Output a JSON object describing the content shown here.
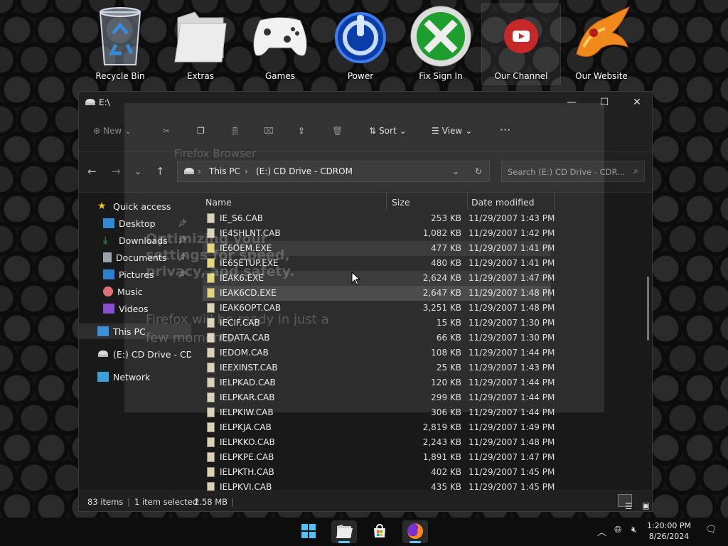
{
  "desktop": {
    "icons": [
      {
        "label": "Recycle Bin"
      },
      {
        "label": "Extras"
      },
      {
        "label": "Games"
      },
      {
        "label": "Power"
      },
      {
        "label": "Fix Sign In"
      },
      {
        "label": "Our Channel"
      },
      {
        "label": "Our Website"
      }
    ]
  },
  "window": {
    "title": "E:\\",
    "controls": {
      "minimize": "—",
      "maximize": "☐",
      "close": "✕"
    }
  },
  "toolbar": {
    "new_label": "New",
    "sort_label": "Sort",
    "view_label": "View",
    "more_label": "···"
  },
  "address": {
    "crumbs": [
      "This PC",
      "(E:) CD Drive - CDROM"
    ],
    "search_placeholder": "Search (E:) CD Drive - CDR..."
  },
  "sidebar": {
    "items": [
      {
        "label": "Quick access"
      },
      {
        "label": "Desktop"
      },
      {
        "label": "Downloads"
      },
      {
        "label": "Documents"
      },
      {
        "label": "Pictures"
      },
      {
        "label": "Music"
      },
      {
        "label": "Videos"
      },
      {
        "label": "This PC"
      },
      {
        "label": "(E:) CD Drive - CDR"
      },
      {
        "label": "Network"
      }
    ]
  },
  "columns": {
    "name": "Name",
    "size": "Size",
    "date": "Date modified"
  },
  "files": [
    {
      "name": "IE_S6.CAB",
      "size": "253 KB",
      "date": "11/29/2007 1:43 PM"
    },
    {
      "name": "IE4SHLNT.CAB",
      "size": "1,082 KB",
      "date": "11/29/2007 1:42 PM"
    },
    {
      "name": "IE6OEM.EXE",
      "size": "477 KB",
      "date": "11/29/2007 1:41 PM"
    },
    {
      "name": "IE6SETUP.EXE",
      "size": "480 KB",
      "date": "11/29/2007 1:41 PM"
    },
    {
      "name": "IEAK6.EXE",
      "size": "2,624 KB",
      "date": "11/29/2007 1:47 PM"
    },
    {
      "name": "IEAK6CD.EXE",
      "size": "2,647 KB",
      "date": "11/29/2007 1:48 PM"
    },
    {
      "name": "IEAK6OPT.CAB",
      "size": "3,251 KB",
      "date": "11/29/2007 1:48 PM"
    },
    {
      "name": "IECIF.CAB",
      "size": "15 KB",
      "date": "11/29/2007 1:30 PM"
    },
    {
      "name": "IEDATA.CAB",
      "size": "66 KB",
      "date": "11/29/2007 1:30 PM"
    },
    {
      "name": "IEDOM.CAB",
      "size": "108 KB",
      "date": "11/29/2007 1:44 PM"
    },
    {
      "name": "IEEXINST.CAB",
      "size": "25 KB",
      "date": "11/29/2007 1:43 PM"
    },
    {
      "name": "IELPKAD.CAB",
      "size": "120 KB",
      "date": "11/29/2007 1:44 PM"
    },
    {
      "name": "IELPKAR.CAB",
      "size": "299 KB",
      "date": "11/29/2007 1:44 PM"
    },
    {
      "name": "IELPKIW.CAB",
      "size": "306 KB",
      "date": "11/29/2007 1:44 PM"
    },
    {
      "name": "IELPKJA.CAB",
      "size": "2,819 KB",
      "date": "11/29/2007 1:49 PM"
    },
    {
      "name": "IELPKKO.CAB",
      "size": "2,243 KB",
      "date": "11/29/2007 1:48 PM"
    },
    {
      "name": "IELPKPE.CAB",
      "size": "1,891 KB",
      "date": "11/29/2007 1:47 PM"
    },
    {
      "name": "IELPKTH.CAB",
      "size": "402 KB",
      "date": "11/29/2007 1:45 PM"
    },
    {
      "name": "IELPKVI.CAB",
      "size": "435 KB",
      "date": "11/29/2007 1:45 PM"
    }
  ],
  "status": {
    "count": "83 items",
    "selection": "1 item selected",
    "size": "2.58 MB"
  },
  "ghost_overlay": {
    "title": "Firefox Browser",
    "headline": "Optimizing your settings for speed, privacy, and safety.",
    "sub": "Firefox will be ready in just a few moments."
  },
  "taskbar": {
    "time": "1:20:00 PM",
    "date": "8/26/2024"
  }
}
